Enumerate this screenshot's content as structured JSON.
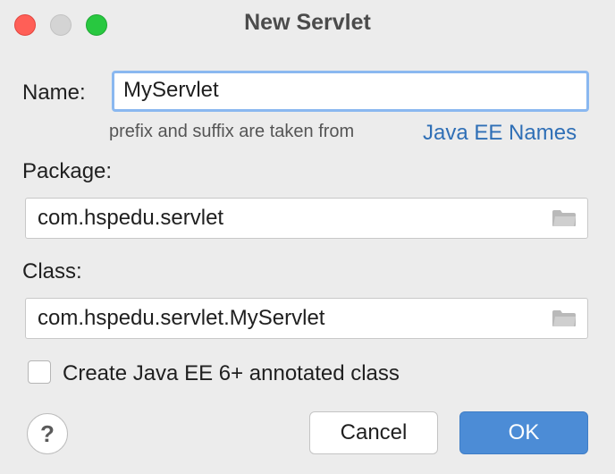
{
  "window": {
    "title": "New Servlet"
  },
  "form": {
    "name_label": "Name:",
    "name_value": "MyServlet",
    "hint_text": "prefix and suffix are taken from",
    "hint_link": "Java EE Names",
    "package_label": "Package:",
    "package_value": "com.hspedu.servlet",
    "class_label": "Class:",
    "class_value": "com.hspedu.servlet.MyServlet",
    "annotated_label": "Create Java EE 6+ annotated class",
    "annotated_checked": false
  },
  "buttons": {
    "help": "?",
    "cancel": "Cancel",
    "ok": "OK"
  },
  "colors": {
    "accent": "#4c8cd6",
    "link": "#2f6fb6",
    "focus_ring": "#8ab8f0"
  }
}
